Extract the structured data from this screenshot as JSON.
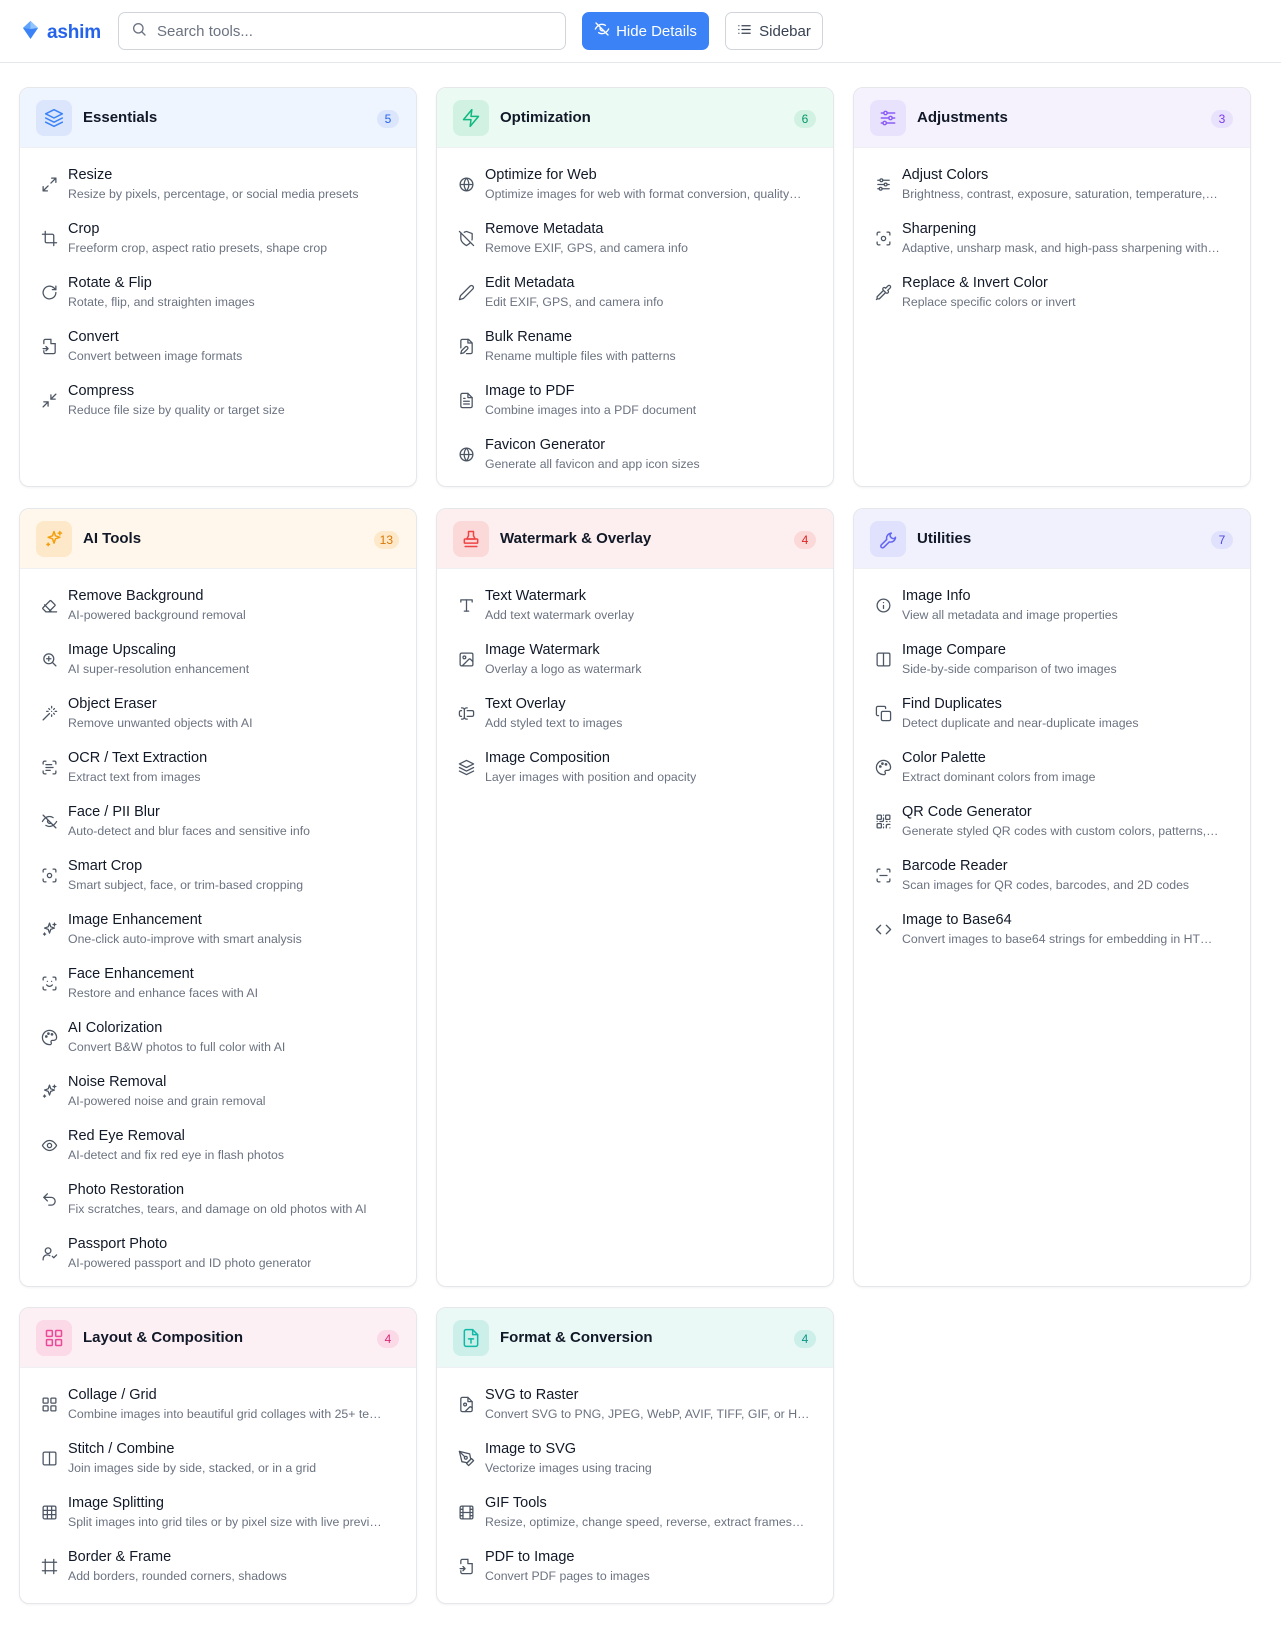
{
  "app": {
    "name": "ashim"
  },
  "search": {
    "placeholder": "Search tools..."
  },
  "toolbar": {
    "hide_details_label": "Hide Details",
    "sidebar_label": "Sidebar"
  },
  "colors": {
    "accent": "#3b82f6",
    "brand": "#2563eb"
  },
  "categories": [
    {
      "title": "Essentials",
      "count": "5",
      "icon": "layers-icon",
      "tools": [
        {
          "name": "Resize",
          "desc": "Resize by pixels, percentage, or social media presets",
          "icon": "maximize-icon"
        },
        {
          "name": "Crop",
          "desc": "Freeform crop, aspect ratio presets, shape crop",
          "icon": "crop-icon"
        },
        {
          "name": "Rotate & Flip",
          "desc": "Rotate, flip, and straighten images",
          "icon": "rotate-icon"
        },
        {
          "name": "Convert",
          "desc": "Convert between image formats",
          "icon": "file-convert-icon"
        },
        {
          "name": "Compress",
          "desc": "Reduce file size by quality or target size",
          "icon": "minimize-icon"
        }
      ]
    },
    {
      "title": "Optimization",
      "count": "6",
      "icon": "zap-icon",
      "tools": [
        {
          "name": "Optimize for Web",
          "desc": "Optimize images for web with format conversion, quality…",
          "icon": "globe-icon"
        },
        {
          "name": "Remove Metadata",
          "desc": "Remove EXIF, GPS, and camera info",
          "icon": "shield-off-icon"
        },
        {
          "name": "Edit Metadata",
          "desc": "Edit EXIF, GPS, and camera info",
          "icon": "pencil-icon"
        },
        {
          "name": "Bulk Rename",
          "desc": "Rename multiple files with patterns",
          "icon": "file-pen-icon"
        },
        {
          "name": "Image to PDF",
          "desc": "Combine images into a PDF document",
          "icon": "file-text-icon"
        },
        {
          "name": "Favicon Generator",
          "desc": "Generate all favicon and app icon sizes",
          "icon": "globe-icon"
        }
      ]
    },
    {
      "title": "Adjustments",
      "count": "3",
      "icon": "sliders-icon",
      "tools": [
        {
          "name": "Adjust Colors",
          "desc": "Brightness, contrast, exposure, saturation, temperature,…",
          "icon": "sliders-icon"
        },
        {
          "name": "Sharpening",
          "desc": "Adaptive, unsharp mask, and high-pass sharpening with…",
          "icon": "focus-icon"
        },
        {
          "name": "Replace & Invert Color",
          "desc": "Replace specific colors or invert",
          "icon": "pipette-icon"
        }
      ]
    },
    {
      "title": "AI Tools",
      "count": "13",
      "icon": "sparkles-icon",
      "tools": [
        {
          "name": "Remove Background",
          "desc": "AI-powered background removal",
          "icon": "eraser-icon"
        },
        {
          "name": "Image Upscaling",
          "desc": "AI super-resolution enhancement",
          "icon": "zoom-in-icon"
        },
        {
          "name": "Object Eraser",
          "desc": "Remove unwanted objects with AI",
          "icon": "wand-icon"
        },
        {
          "name": "OCR / Text Extraction",
          "desc": "Extract text from images",
          "icon": "scan-text-icon"
        },
        {
          "name": "Face / PII Blur",
          "desc": "Auto-detect and blur faces and sensitive info",
          "icon": "eye-off-icon"
        },
        {
          "name": "Smart Crop",
          "desc": "Smart subject, face, or trim-based cropping",
          "icon": "focus-icon"
        },
        {
          "name": "Image Enhancement",
          "desc": "One-click auto-improve with smart analysis",
          "icon": "sparkles-icon"
        },
        {
          "name": "Face Enhancement",
          "desc": "Restore and enhance faces with AI",
          "icon": "scan-face-icon"
        },
        {
          "name": "AI Colorization",
          "desc": "Convert B&W photos to full color with AI",
          "icon": "palette-icon"
        },
        {
          "name": "Noise Removal",
          "desc": "AI-powered noise and grain removal",
          "icon": "sparkles-icon"
        },
        {
          "name": "Red Eye Removal",
          "desc": "AI-detect and fix red eye in flash photos",
          "icon": "eye-icon"
        },
        {
          "name": "Photo Restoration",
          "desc": "Fix scratches, tears, and damage on old photos with AI",
          "icon": "undo-icon"
        },
        {
          "name": "Passport Photo",
          "desc": "AI-powered passport and ID photo generator",
          "icon": "user-icon"
        }
      ]
    },
    {
      "title": "Watermark & Overlay",
      "count": "4",
      "icon": "stamp-icon",
      "tools": [
        {
          "name": "Text Watermark",
          "desc": "Add text watermark overlay",
          "icon": "type-icon"
        },
        {
          "name": "Image Watermark",
          "desc": "Overlay a logo as watermark",
          "icon": "image-icon"
        },
        {
          "name": "Text Overlay",
          "desc": "Add styled text to images",
          "icon": "text-overlay-icon"
        },
        {
          "name": "Image Composition",
          "desc": "Layer images with position and opacity",
          "icon": "layers-icon"
        }
      ]
    },
    {
      "title": "Utilities",
      "count": "7",
      "icon": "wrench-icon",
      "tools": [
        {
          "name": "Image Info",
          "desc": "View all metadata and image properties",
          "icon": "info-icon"
        },
        {
          "name": "Image Compare",
          "desc": "Side-by-side comparison of two images",
          "icon": "columns-icon"
        },
        {
          "name": "Find Duplicates",
          "desc": "Detect duplicate and near-duplicate images",
          "icon": "copy-icon"
        },
        {
          "name": "Color Palette",
          "desc": "Extract dominant colors from image",
          "icon": "palette-icon"
        },
        {
          "name": "QR Code Generator",
          "desc": "Generate styled QR codes with custom colors, patterns,…",
          "icon": "qr-code-icon"
        },
        {
          "name": "Barcode Reader",
          "desc": "Scan images for QR codes, barcodes, and 2D codes",
          "icon": "scan-line-icon"
        },
        {
          "name": "Image to Base64",
          "desc": "Convert images to base64 strings for embedding in HT…",
          "icon": "code-icon"
        }
      ]
    },
    {
      "title": "Layout & Composition",
      "count": "4",
      "icon": "grid-icon",
      "tools": [
        {
          "name": "Collage / Grid",
          "desc": "Combine images into beautiful grid collages with 25+ te…",
          "icon": "grid-icon"
        },
        {
          "name": "Stitch / Combine",
          "desc": "Join images side by side, stacked, or in a grid",
          "icon": "columns-icon"
        },
        {
          "name": "Image Splitting",
          "desc": "Split images into grid tiles or by pixel size with live previ…",
          "icon": "table-icon"
        },
        {
          "name": "Border & Frame",
          "desc": "Add borders, rounded corners, shadows",
          "icon": "frame-icon"
        }
      ]
    },
    {
      "title": "Format & Conversion",
      "count": "4",
      "icon": "file-type-icon",
      "tools": [
        {
          "name": "SVG to Raster",
          "desc": "Convert SVG to PNG, JPEG, WebP, AVIF, TIFF, GIF, or HE…",
          "icon": "file-image-icon"
        },
        {
          "name": "Image to SVG",
          "desc": "Vectorize images using tracing",
          "icon": "pen-tool-icon"
        },
        {
          "name": "GIF Tools",
          "desc": "Resize, optimize, change speed, reverse, extract frames…",
          "icon": "film-icon"
        },
        {
          "name": "PDF to Image",
          "desc": "Convert PDF pages to images",
          "icon": "file-convert-icon"
        }
      ]
    }
  ]
}
